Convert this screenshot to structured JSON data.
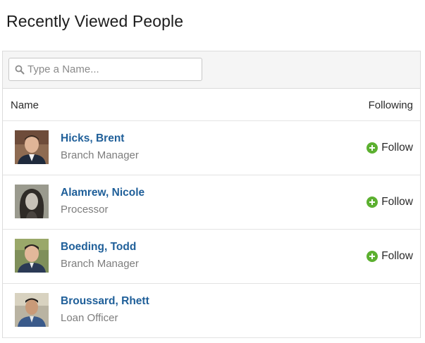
{
  "page": {
    "title": "Recently Viewed People"
  },
  "search": {
    "placeholder": "Type a Name...",
    "icon": "search-icon"
  },
  "table": {
    "columns": {
      "name": "Name",
      "following": "Following"
    },
    "rows": [
      {
        "name": "Hicks, Brent",
        "title": "Branch Manager",
        "follow_label": "Follow",
        "show_follow": true
      },
      {
        "name": "Alamrew, Nicole",
        "title": "Processor",
        "follow_label": "Follow",
        "show_follow": true
      },
      {
        "name": "Boeding, Todd",
        "title": "Branch Manager",
        "follow_label": "Follow",
        "show_follow": true
      },
      {
        "name": "Broussard, Rhett",
        "title": "Loan Officer",
        "follow_label": "",
        "show_follow": false
      }
    ]
  },
  "colors": {
    "name_link": "#1f5f99",
    "follow_icon": "#5cb030",
    "subtitle": "#7d7d7d"
  }
}
